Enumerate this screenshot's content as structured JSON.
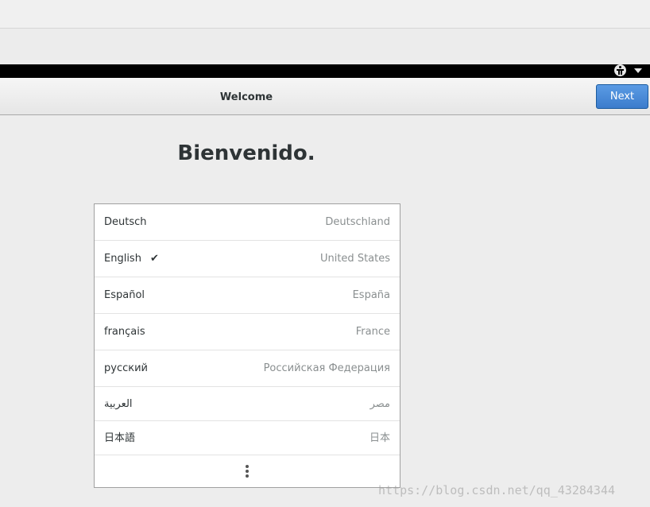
{
  "header": {
    "title": "Welcome",
    "next_label": "Next"
  },
  "main": {
    "heading": "Bienvenido."
  },
  "languages": [
    {
      "name": "Deutsch",
      "region": "Deutschland",
      "selected": false
    },
    {
      "name": "English",
      "region": "United States",
      "selected": true,
      "check": "✔"
    },
    {
      "name": "Español",
      "region": "España",
      "selected": false
    },
    {
      "name": "français",
      "region": "France",
      "selected": false
    },
    {
      "name": "русский",
      "region": "Российская Федерация",
      "selected": false
    },
    {
      "name": "العربية",
      "region": "مصر",
      "selected": false
    },
    {
      "name": "日本語",
      "region": "日本",
      "selected": false
    }
  ],
  "watermark": "https://blog.csdn.net/qq_43284344",
  "icons": {
    "topbar": [
      "accessibility-icon",
      "system-menu-chevron-down-icon"
    ],
    "more": "more-vertical-icon"
  },
  "colors": {
    "accent": "#4a8ad8",
    "topbar": "#000000"
  }
}
